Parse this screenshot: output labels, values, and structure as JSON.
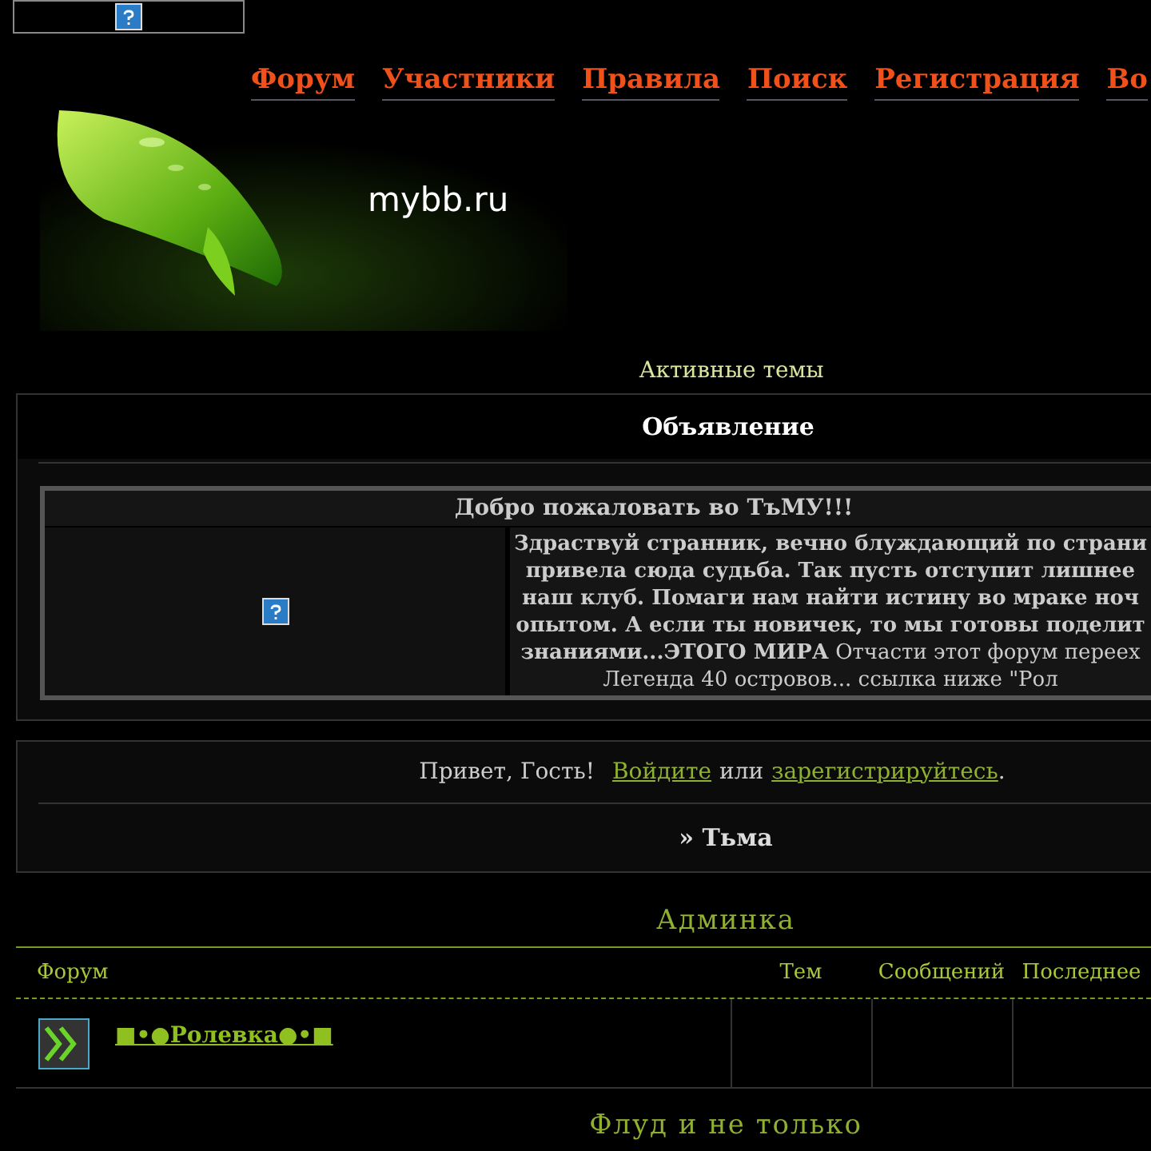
{
  "nav": [
    "Форум",
    "Участники",
    "Правила",
    "Поиск",
    "Регистрация",
    "Во"
  ],
  "logo": "mybb.ru",
  "active_topics_link": "Активные темы",
  "announcement": {
    "title": "Объявление",
    "heading": "Добро пожаловать во ТъМУ!!!",
    "lines": [
      "**Здраствуй странник, вечно блуждающий по страни**",
      "**привела сюда судьба. Так пусть отступит лишнее**",
      "**наш клуб. Помаги нам найти истину во мраке ноч**",
      "**опытом. А если ты новичек, то мы готовы поделит**",
      "**знаниями...ЭТОГО МИРА** Отчасти этот форум переех",
      "Легенда 40 островов... ссылка ниже \"Рол"
    ]
  },
  "guest": {
    "greeting": "Привет, Гость!",
    "login_link": "Войдите",
    "or": "или",
    "register_link": "зарегистрируйтесь",
    "end": "."
  },
  "breadcrumb": "» Тьма",
  "categories": [
    {
      "title": "Админка",
      "columns": [
        "Форум",
        "Тем",
        "Сообщений",
        "Последнее"
      ],
      "forums": [
        {
          "name": "■•●Ролевка●•■"
        }
      ]
    },
    {
      "title": "Флуд и не только"
    }
  ]
}
